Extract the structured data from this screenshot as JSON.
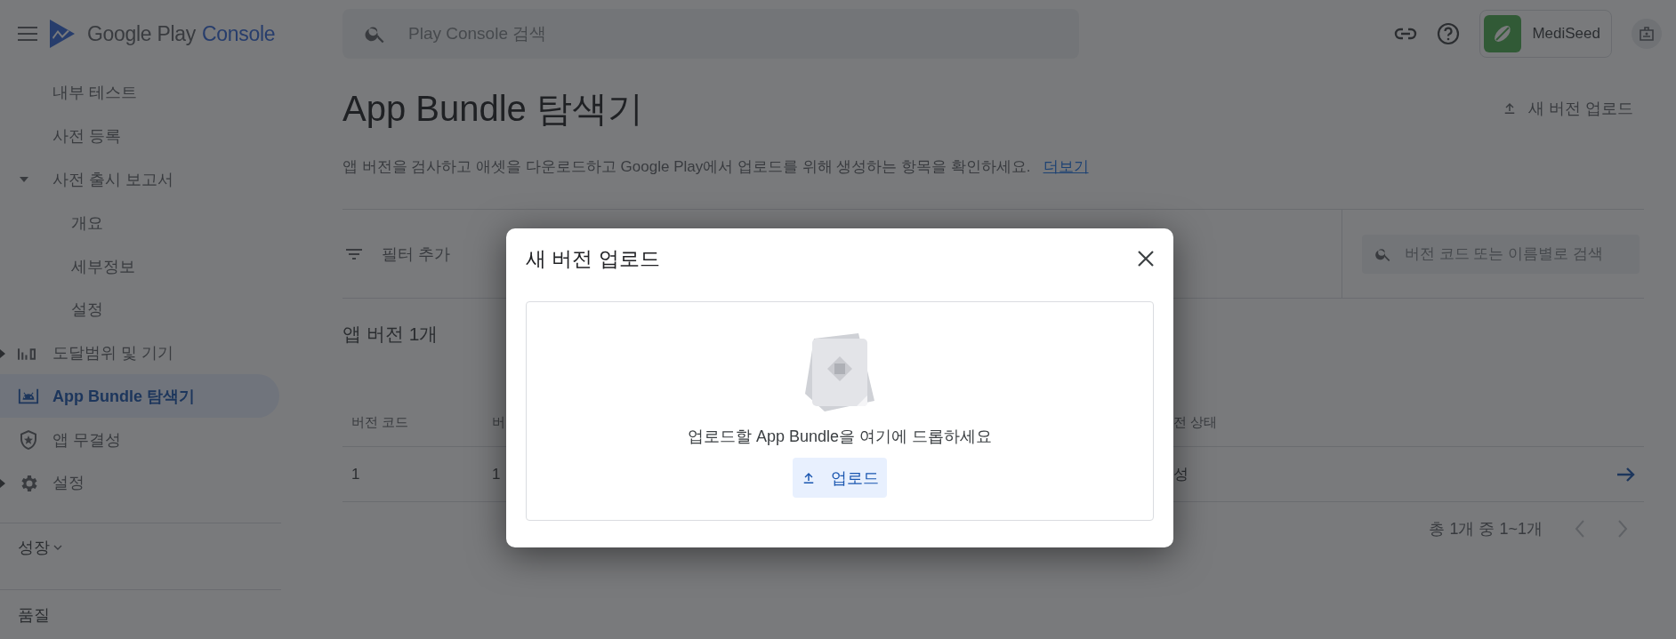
{
  "header": {
    "brand": "Google Play",
    "product": "Console",
    "search": {
      "placeholder": "Play Console 검색"
    },
    "account": {
      "name": "MediSeed"
    }
  },
  "sidebar": {
    "items": [
      {
        "label": "내부 테스트",
        "selected": false
      },
      {
        "label": "사전 등록",
        "selected": false
      },
      {
        "label": "사전 출시 보고서",
        "selected": false,
        "expanded": true,
        "children": [
          {
            "label": "개요",
            "selected": false
          },
          {
            "label": "세부정보",
            "selected": false
          },
          {
            "label": "설정",
            "selected": false
          }
        ]
      },
      {
        "label": "도달범위 및 기기",
        "selected": false,
        "expanded": false
      },
      {
        "label": "App Bundle 탐색기",
        "selected": true
      },
      {
        "label": "앱 무결성",
        "selected": false
      },
      {
        "label": "설정",
        "selected": false,
        "expanded": false
      }
    ],
    "sections": [
      {
        "label": "성장",
        "expanded": false
      },
      {
        "label": "품질"
      }
    ]
  },
  "page": {
    "title": "App Bundle 탐색기",
    "upload_button": "새 버전 업로드",
    "description": "앱 버전을 검사하고 애셋을 다운로드하고 Google Play에서 업로드를 위해 생성하는 항목을 확인하세요.",
    "more_link": "더보기",
    "filter": "필터 추가",
    "search": {
      "placeholder": "버전 코드 또는 이름별로 검색"
    },
    "count": "앱 버전 1개",
    "table": {
      "columns": [
        "버전 코드",
        "버",
        "전 상태"
      ],
      "rows": [
        [
          "1",
          "1",
          "성"
        ]
      ]
    },
    "pagination": "총 1개 중 1~1개"
  },
  "dialog": {
    "title": "새 버전 업로드",
    "drop_text": "업로드할 App Bundle을 여기에 드롭하세요",
    "button": "업로드"
  }
}
